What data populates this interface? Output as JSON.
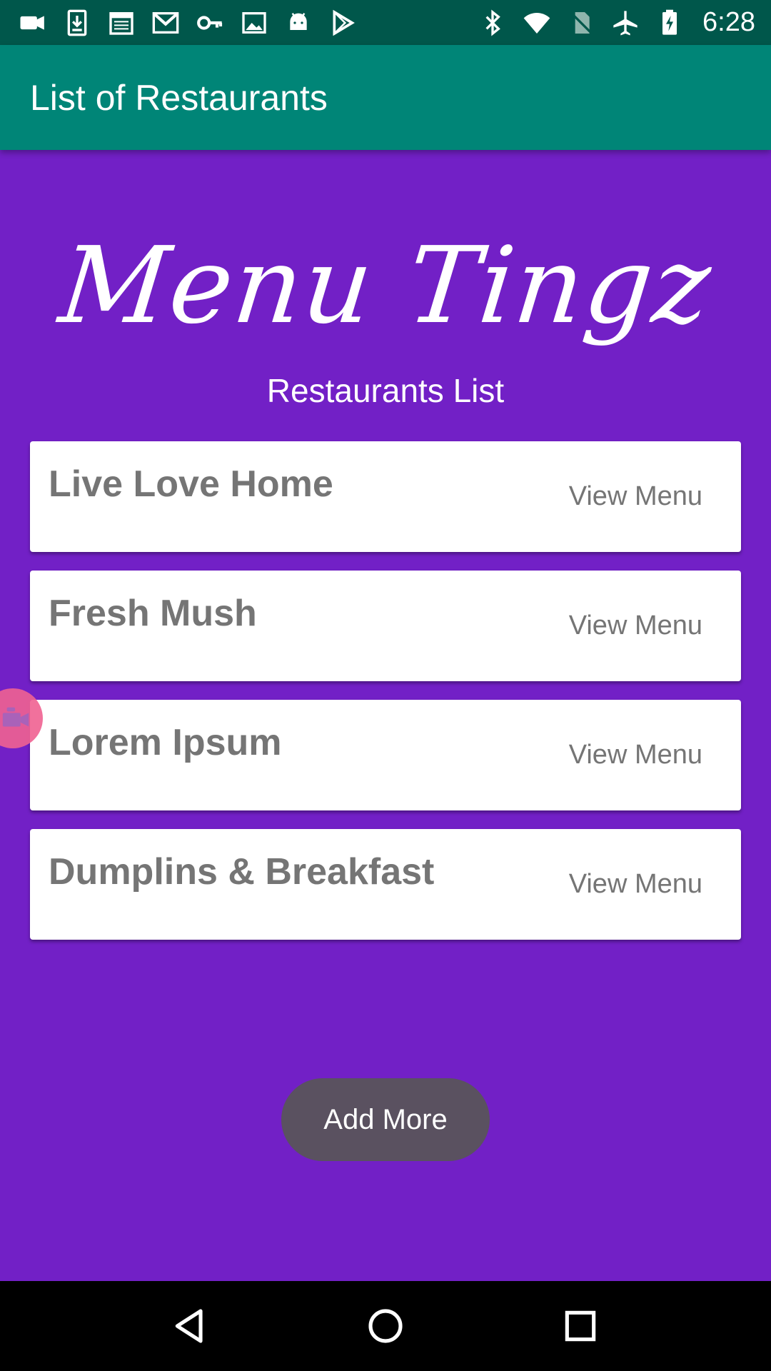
{
  "status_bar": {
    "time": "6:28",
    "left_icons": [
      "video-camera-icon",
      "download-icon",
      "calendar-icon",
      "gmail-icon",
      "key-icon",
      "image-icon",
      "android-icon",
      "play-store-icon"
    ],
    "right_icons": [
      "bluetooth-icon",
      "wifi-icon",
      "no-sim-icon",
      "airplane-icon",
      "battery-charging-icon"
    ]
  },
  "app_bar": {
    "title": "List of Restaurants"
  },
  "logo": {
    "text": "Menu Tingz"
  },
  "section": {
    "title": "Restaurants List"
  },
  "restaurants": [
    {
      "name": "Live Love Home",
      "action": "View Menu"
    },
    {
      "name": "Fresh Mush",
      "action": "View Menu"
    },
    {
      "name": "Lorem Ipsum",
      "action": "View Menu"
    },
    {
      "name": "Dumplins & Breakfast",
      "action": "View Menu"
    }
  ],
  "add_button": {
    "label": "Add More"
  },
  "floating_icon": "camera-bubble-icon",
  "nav_bar": {
    "icons": [
      "back-icon",
      "home-icon",
      "recents-icon"
    ]
  },
  "colors": {
    "status_bar": "#00574b",
    "app_bar": "#008577",
    "background": "#7220c6",
    "card": "#ffffff",
    "card_text": "#757575",
    "button": "#5a5160",
    "nav_bar": "#000000"
  }
}
